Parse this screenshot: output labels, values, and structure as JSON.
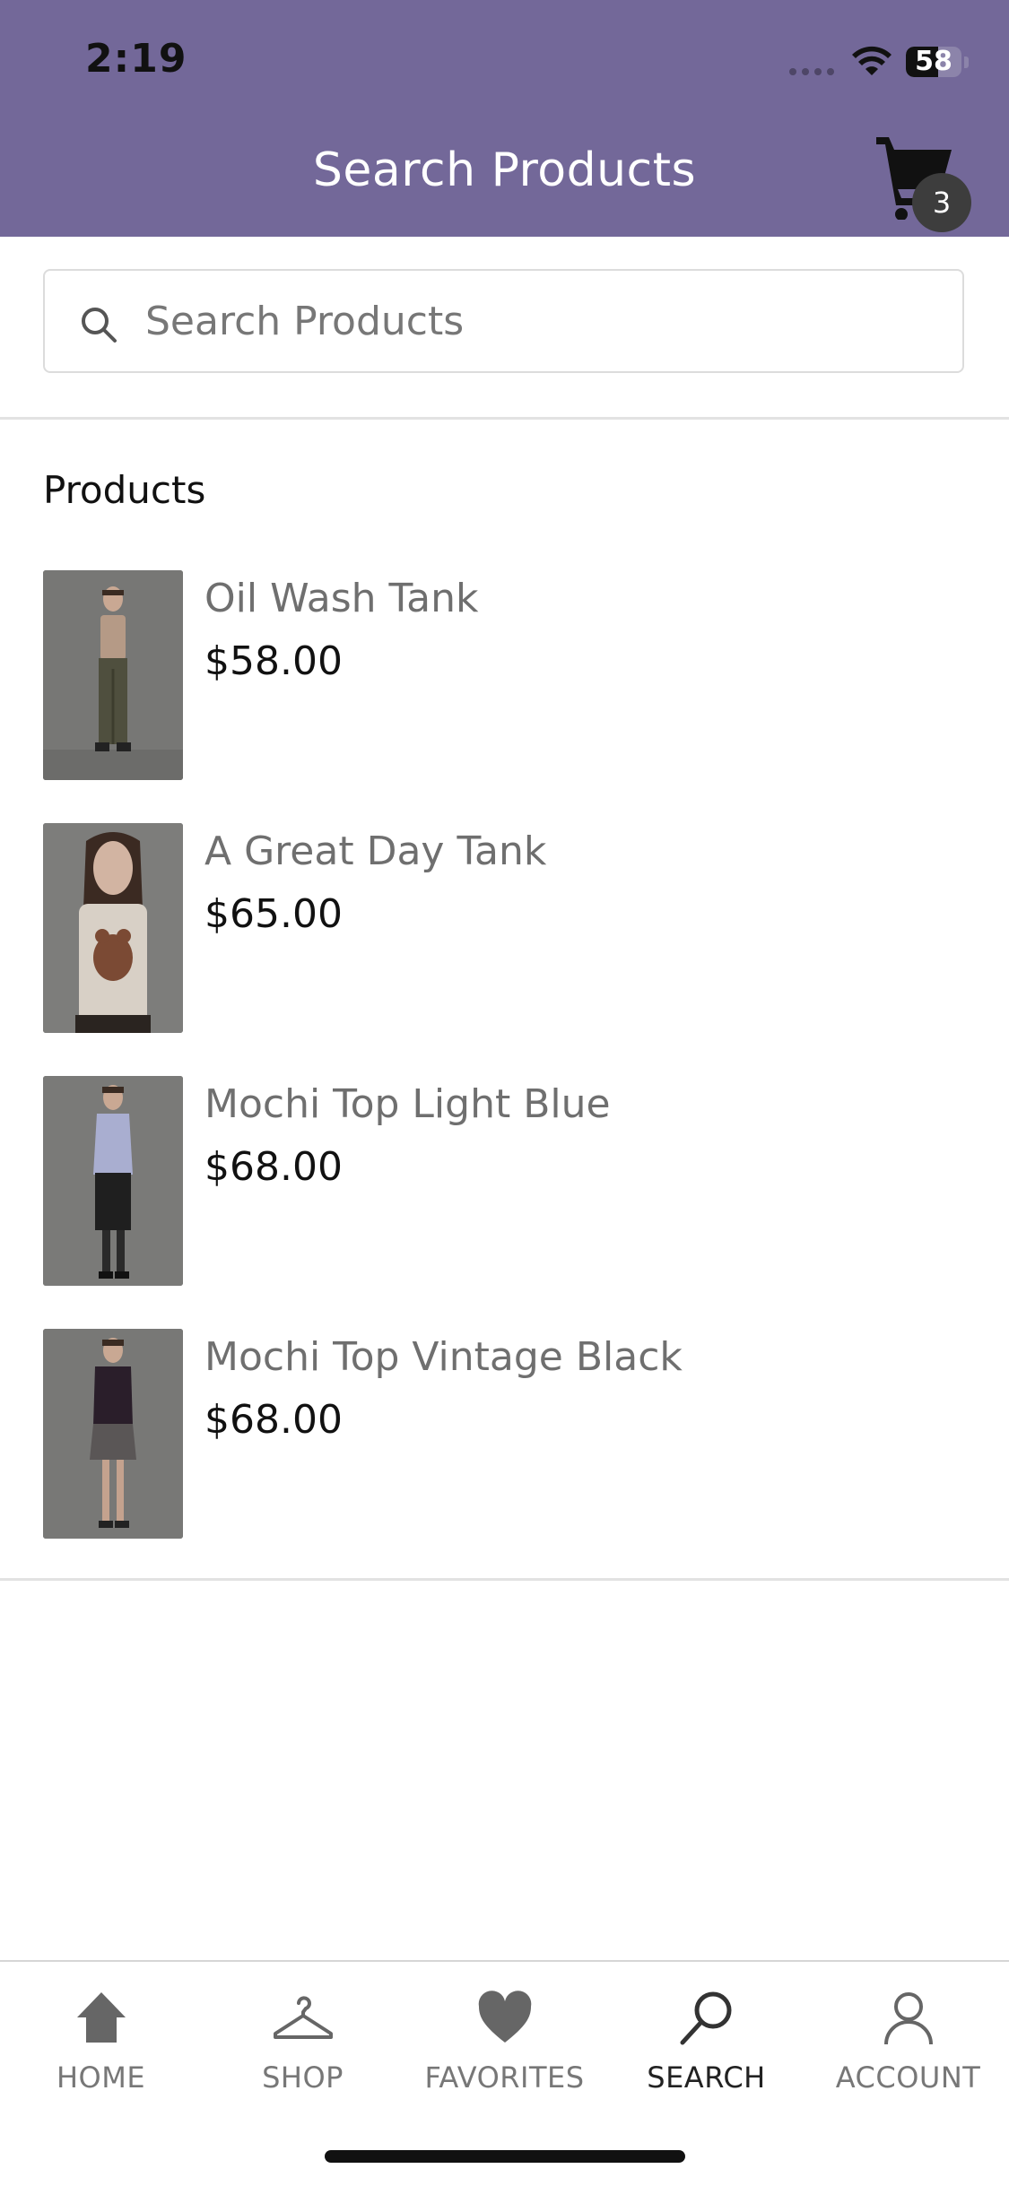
{
  "status_bar": {
    "time": "2:19",
    "battery_level": "58"
  },
  "header": {
    "title": "Search Products",
    "cart_count": "3",
    "background_color": "#736899"
  },
  "search": {
    "placeholder": "Search Products",
    "value": ""
  },
  "products_section": {
    "title": "Products",
    "items": [
      {
        "name": "Oil Wash Tank",
        "price": "$58.00"
      },
      {
        "name": "A Great Day Tank",
        "price": "$65.00"
      },
      {
        "name": "Mochi Top Light Blue",
        "price": "$68.00"
      },
      {
        "name": "Mochi Top Vintage Black",
        "price": "$68.00"
      }
    ]
  },
  "tab_bar": {
    "active": "search",
    "tabs": [
      {
        "label": "HOME",
        "icon": "home-icon"
      },
      {
        "label": "SHOP",
        "icon": "hanger-icon"
      },
      {
        "label": "FAVORITES",
        "icon": "heart-icon"
      },
      {
        "label": "SEARCH",
        "icon": "search-icon"
      },
      {
        "label": "ACCOUNT",
        "icon": "person-icon"
      }
    ]
  }
}
